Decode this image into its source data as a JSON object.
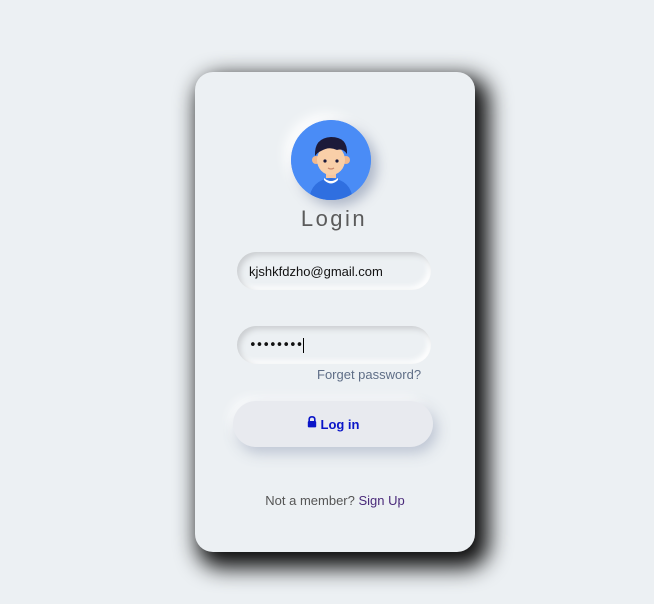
{
  "card": {
    "title": "Login",
    "avatar_icon": "user-avatar-icon"
  },
  "form": {
    "email_value": "kjshkfdzho@gmail.com",
    "password_masked": "••••••••",
    "forget_password_label": "Forget password?",
    "login_button_label": "Log in",
    "login_button_icon": "lock-icon"
  },
  "footer": {
    "prompt": "Not a member?",
    "signup_label": "Sign Up"
  },
  "colors": {
    "background": "#ecf0f3",
    "avatar_bg": "#4a8cf6",
    "login_text": "#0a15c8",
    "signup_link": "#4a2a7a"
  }
}
